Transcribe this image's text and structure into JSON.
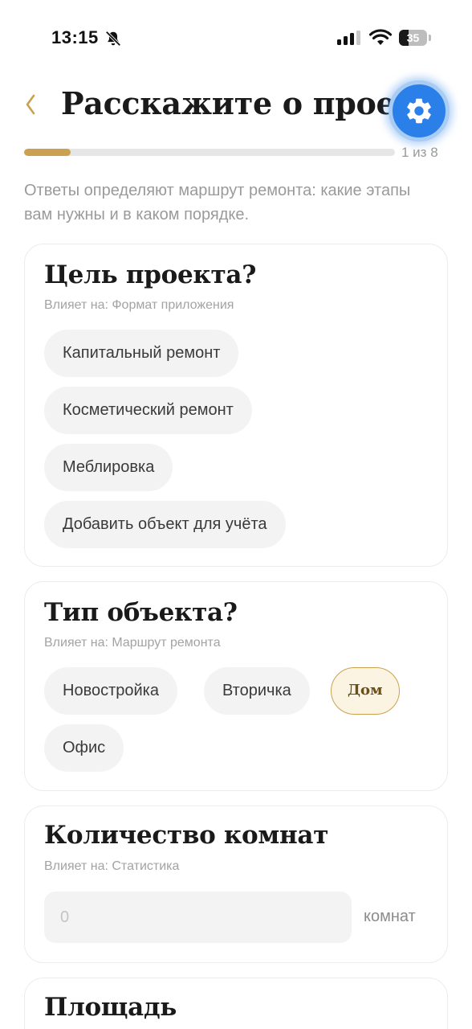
{
  "status_bar": {
    "time": "13:15",
    "battery": "35",
    "battery_level": 0.35,
    "icons": [
      "bell-slash-icon",
      "cellular-signal-icon",
      "wifi-icon",
      "battery-icon"
    ]
  },
  "header": {
    "back_icon": "chevron-left-icon",
    "title": "Расскажите о проекте",
    "settings_icon": "gear-icon"
  },
  "progress": {
    "current": 1,
    "total": 8,
    "label": "1 из 8",
    "fraction": 0.125
  },
  "intro": "Ответы определяют маршрут ремонта: какие этапы вам нужны и в каком порядке.",
  "questions": [
    {
      "title": "Цель проекта?",
      "affects": "Влияет на: Формат приложения",
      "options": [
        "Капитальный ремонт",
        "Косметический ремонт",
        "Меблировка",
        "Добавить объект для учёта"
      ]
    },
    {
      "title": "Тип объекта?",
      "affects": "Влияет на: Маршрут ремонта",
      "options": [
        "Новостройка",
        "Вторичка",
        "Дом",
        "Офис"
      ],
      "selected": "Дом"
    },
    {
      "title": "Количество комнат",
      "affects": "Влияет на: Статистика",
      "input": {
        "value": "",
        "placeholder": "0",
        "unit": "комнат"
      }
    },
    {
      "title": "Площадь"
    }
  ],
  "colors": {
    "accent_gold": "#caa150",
    "fab_blue": "#2a80e8",
    "chip_bg": "#f3f3f3",
    "selected_chip_bg": "#fcf4e3"
  }
}
